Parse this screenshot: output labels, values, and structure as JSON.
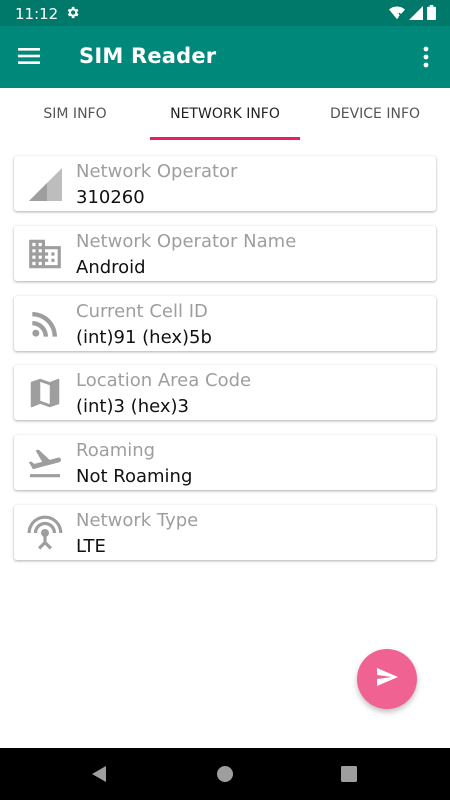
{
  "status_bar": {
    "time": "11:12",
    "icons": [
      "gear-icon",
      "wifi-icon",
      "signal-icon",
      "battery-icon"
    ]
  },
  "app_bar": {
    "title": "SIM Reader",
    "background": "#00897b"
  },
  "tabs": [
    {
      "label": "SIM INFO",
      "active": false
    },
    {
      "label": "NETWORK INFO",
      "active": true
    },
    {
      "label": "DEVICE INFO",
      "active": false
    }
  ],
  "accent_color": "#e91e63",
  "cards": [
    {
      "icon": "signal-strength-icon",
      "label": "Network Operator",
      "value": "310260"
    },
    {
      "icon": "building-icon",
      "label": "Network Operator Name",
      "value": "Android"
    },
    {
      "icon": "rss-icon",
      "label": "Current Cell ID",
      "value": "(int)91 (hex)5b"
    },
    {
      "icon": "map-icon",
      "label": "Location Area Code",
      "value": "(int)3 (hex)3"
    },
    {
      "icon": "airplane-departure-icon",
      "label": "Roaming",
      "value": "Not Roaming"
    },
    {
      "icon": "antenna-icon",
      "label": "Network Type",
      "value": "LTE"
    }
  ],
  "fab": {
    "icon": "send-icon",
    "color": "#f06292"
  },
  "nav_bar": {
    "icons": [
      "back-icon",
      "home-icon",
      "recents-icon"
    ]
  }
}
